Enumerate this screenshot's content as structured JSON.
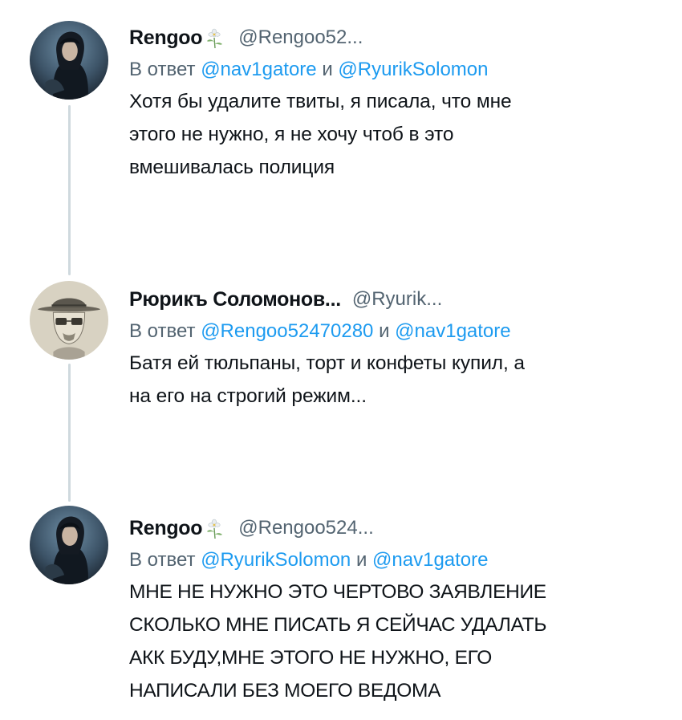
{
  "tweets": [
    {
      "display_name": "Rengoo",
      "has_flower_badge": true,
      "handle": "@Rengoo52...",
      "reply_prefix": "В ответ",
      "mention_1": "@nav1gatore",
      "reply_joiner": "и",
      "mention_2": "@RyurikSolomon",
      "text_lines": [
        "Хотя бы удалите твиты, я писала, что мне",
        "этого не нужно, я не хочу чтоб в это",
        "вмешивалась полиция"
      ],
      "avatar": "girl-dark-portrait-avatar"
    },
    {
      "display_name": "Рюрикъ Соломонов...",
      "has_flower_badge": false,
      "handle": "@Ryurik...",
      "reply_prefix": "В ответ",
      "mention_1": "@Rengoo52470280",
      "reply_joiner": "и",
      "mention_2": "@nav1gatore",
      "text_lines": [
        "Батя ей тюльпаны, торт и конфеты купил, а",
        "на его на строгий режим..."
      ],
      "avatar": "heisenberg-sketch-avatar"
    },
    {
      "display_name": "Rengoo",
      "has_flower_badge": true,
      "handle": "@Rengoo524...",
      "reply_prefix": "В ответ",
      "mention_1": "@RyurikSolomon",
      "reply_joiner": "и",
      "mention_2": "@nav1gatore",
      "text_lines": [
        "МНЕ НЕ НУЖНО ЭТО ЧЕРТОВО ЗАЯВЛЕНИЕ",
        "СКОЛЬКО МНЕ ПИСАТЬ Я СЕЙЧАС УДАЛАТЬ",
        "АКК БУДУ,МНЕ ЭТОГО НЕ НУЖНО, ЕГО",
        "НАПИСАЛИ БЕЗ МОЕГО ВЕДОМА"
      ],
      "avatar": "girl-dark-portrait-avatar"
    }
  ],
  "colors": {
    "text": "#0f1419",
    "secondary": "#536471",
    "link": "#1d9bf0",
    "thread_line": "#cfd9de",
    "background": "#ffffff"
  }
}
